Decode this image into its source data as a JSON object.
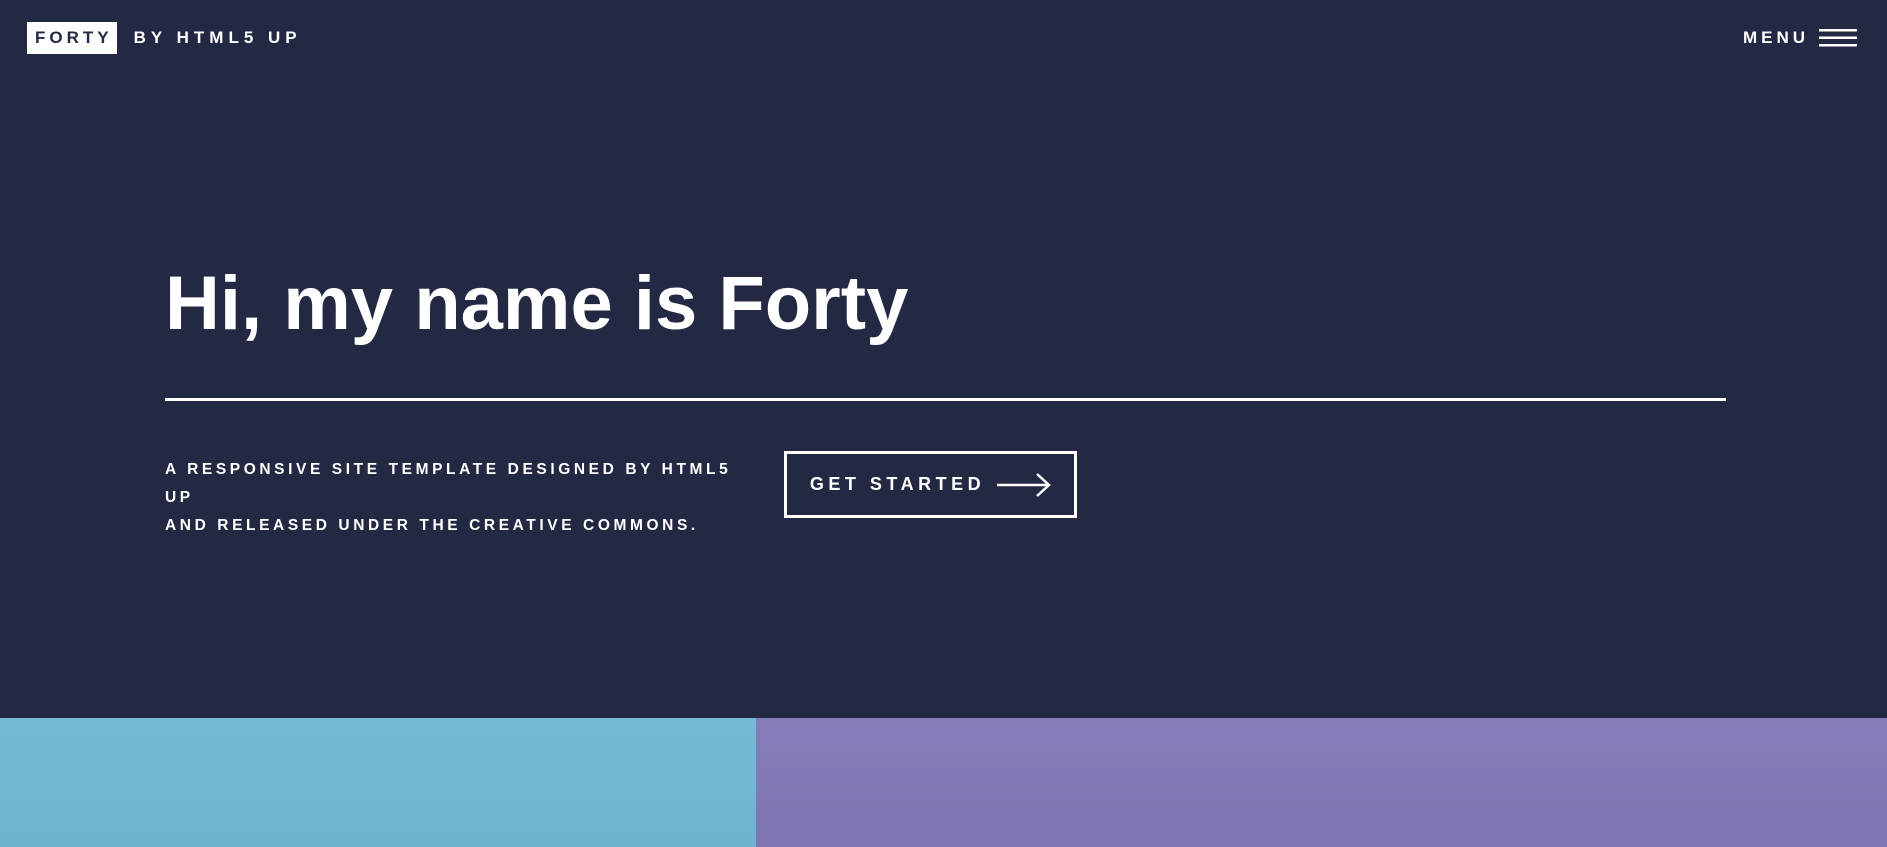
{
  "header": {
    "logo_box": "FORTY",
    "logo_rest": "BY HTML5 UP",
    "menu_label": "MENU"
  },
  "banner": {
    "title": "Hi, my name is Forty",
    "text_line1": "A responsive site template designed by HTML5 UP",
    "text_line2": "and released under the Creative Commons.",
    "cta_label": "GET STARTED"
  },
  "icons": {
    "menu": "hamburger-icon",
    "cta": "right-arrow-icon"
  },
  "colors": {
    "background": "#242943",
    "text": "#ffffff",
    "tile_1": "#6fb8d4",
    "tile_2": "#8079b6"
  }
}
